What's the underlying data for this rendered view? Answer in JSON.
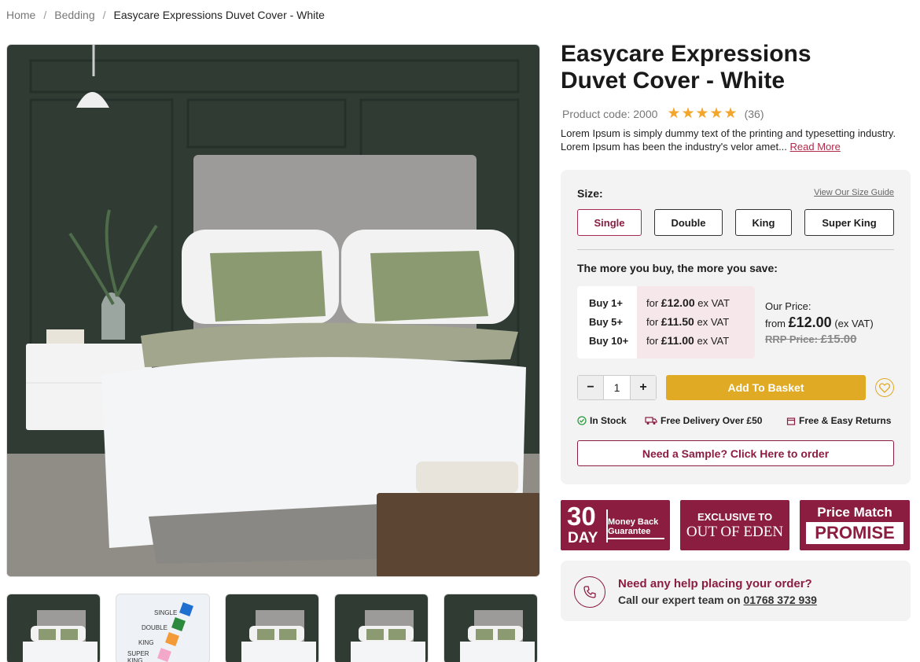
{
  "breadcrumb": {
    "home": "Home",
    "bedding": "Bedding",
    "current": "Easycare Expressions Duvet Cover - White",
    "sep": "/"
  },
  "product": {
    "title_line1": "Easycare Expressions",
    "title_line2": "Duvet Cover - White",
    "code": "Product code: 2000",
    "stars": "★★★★★",
    "rating": 5,
    "reviews": "(36)",
    "description": "Lorem Ipsum is simply dummy text of the printing and typesetting industry. Lorem Ipsum has been the industry's velor amet...",
    "read_more": "Read More"
  },
  "thumbnails": [
    {
      "alt": "bed-image"
    },
    {
      "sizes": [
        "SINGLE",
        "DOUBLE",
        "KING",
        "SUPER KING"
      ]
    },
    {
      "alt": "bed-image"
    },
    {
      "alt": "bed-image"
    },
    {
      "alt": "bed-image"
    }
  ],
  "size": {
    "label": "Size:",
    "guide": "View Our Size Guide",
    "options": [
      "Single",
      "Double",
      "King",
      "Super King"
    ],
    "selected": "Single"
  },
  "pricing": {
    "save_title": "The more you buy, the more you save:",
    "tiers": [
      {
        "qty": "Buy 1+",
        "for": "for",
        "price": "£12.00",
        "vat": "ex VAT"
      },
      {
        "qty": "Buy 5+",
        "for": "for",
        "price": "£11.50",
        "vat": "ex VAT"
      },
      {
        "qty": "Buy 10+",
        "for": "for",
        "price": "£11.00",
        "vat": "ex VAT"
      }
    ],
    "our_price_label": "Our Price:",
    "from": "from",
    "our_price": "£12.00",
    "ex_vat": "(ex VAT)",
    "rrp_label": "RRP Price:",
    "rrp": "£15.00"
  },
  "basket": {
    "minus": "−",
    "plus": "+",
    "quantity": "1",
    "add_label": "Add To Basket"
  },
  "usps": {
    "stock": "In Stock",
    "delivery": "Free Delivery Over £50",
    "returns": "Free & Easy Returns"
  },
  "sample": "Need a Sample? Click Here to order",
  "badges": {
    "money_back": {
      "number": "30",
      "day": "DAY",
      "line1": "Money Back",
      "line2": "Guarantee"
    },
    "exclusive": {
      "line1": "EXCLUSIVE TO",
      "brand": "OUT OF EDEN"
    },
    "price_match": {
      "line1": "Price Match",
      "line2": "PROMISE"
    }
  },
  "help": {
    "question": "Need any help placing your order?",
    "call": "Call our expert team on",
    "phone": "01768 372 939"
  },
  "colors": {
    "accent": "#8b1d41",
    "gold": "#e0aa25",
    "stars": "#f2a62b"
  }
}
